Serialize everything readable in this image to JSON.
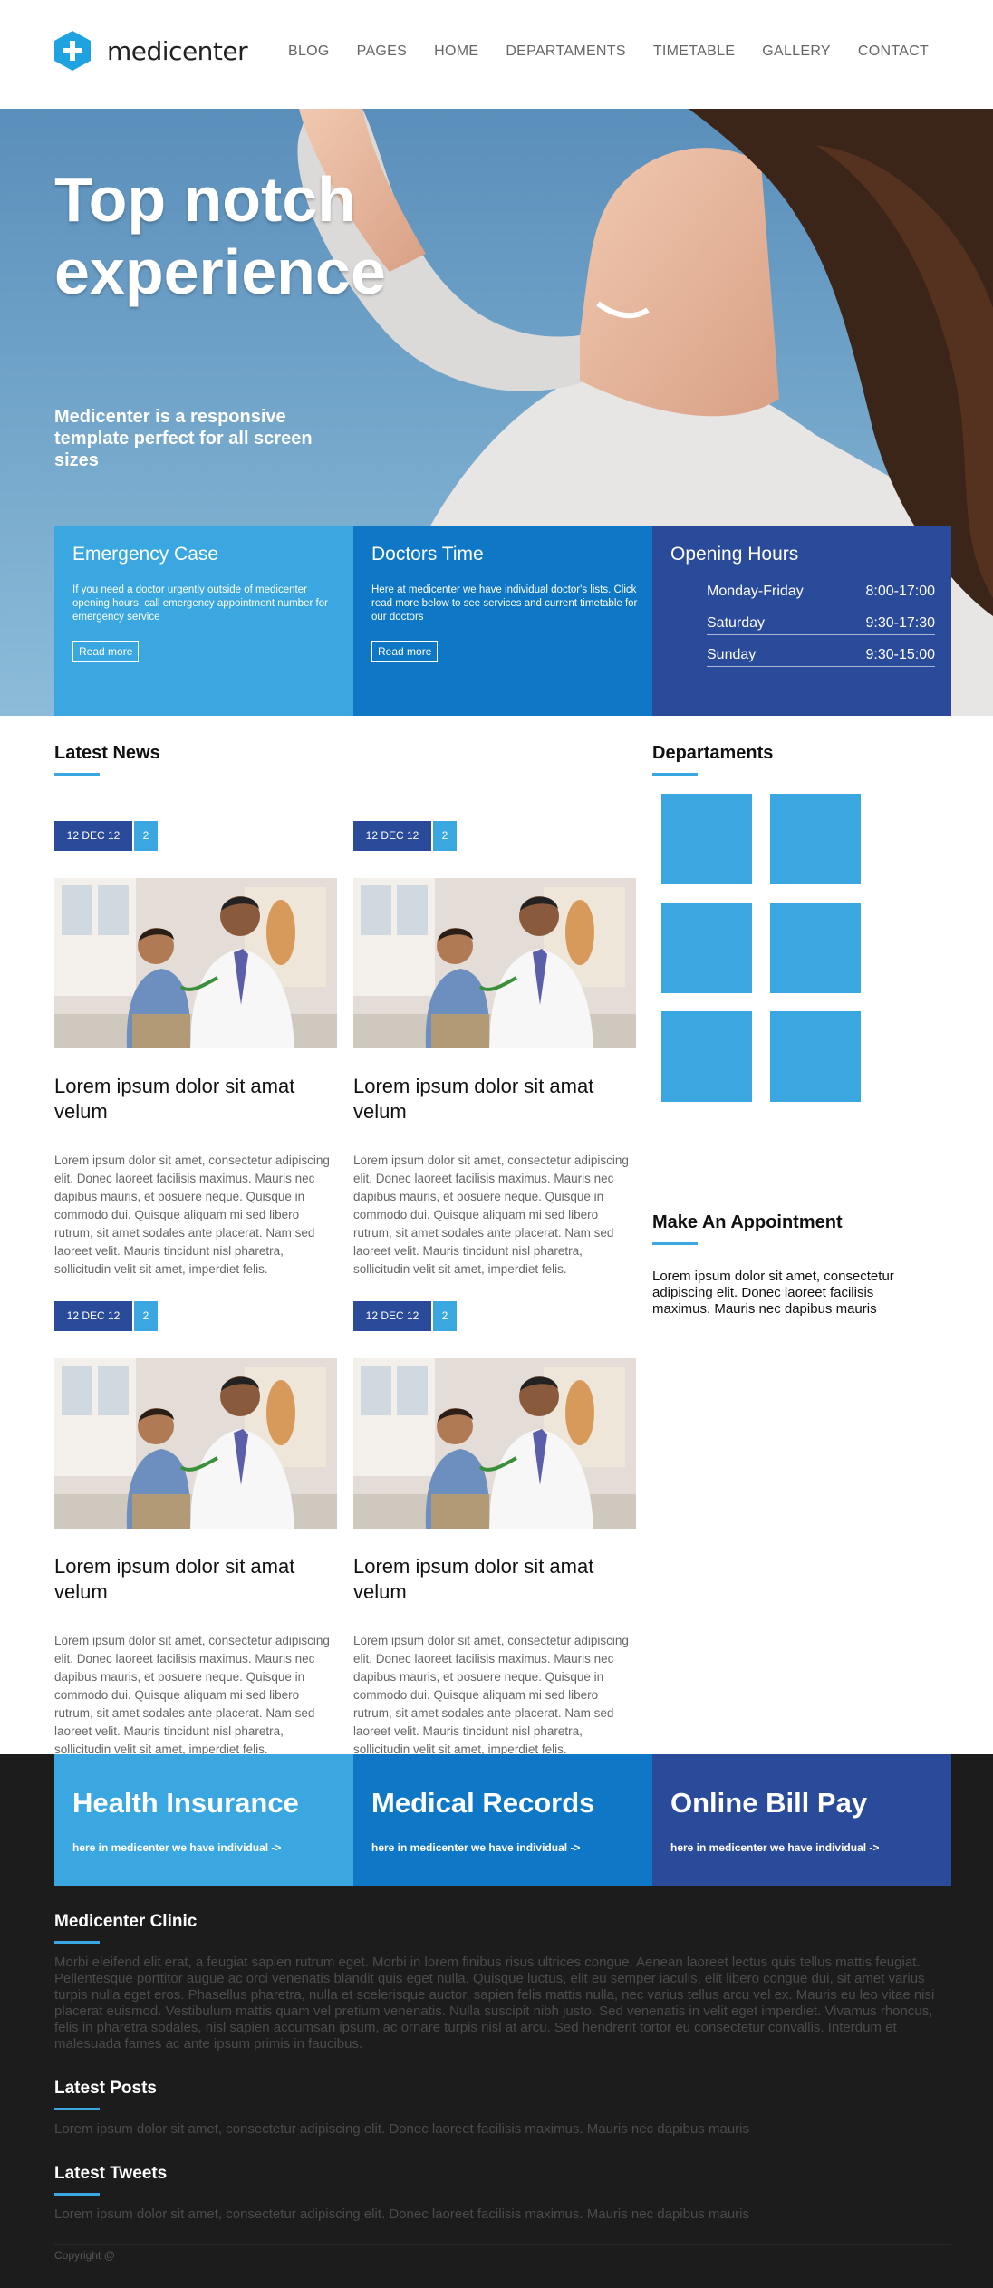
{
  "brand": {
    "name": "medicenter",
    "accent": "#3aa7e0",
    "navy": "#2a4a9a",
    "mid_blue": "#0f78c6"
  },
  "nav": [
    "BLOG",
    "PAGES",
    "HOME",
    "DEPARTAMENTS",
    "TIMETABLE",
    "GALLERY",
    "CONTACT"
  ],
  "hero": {
    "title": "Top notch experience",
    "subtitle": "Medicenter is a responsive template perfect for all screen sizes"
  },
  "info": {
    "emergency": {
      "title": "Emergency Case",
      "text": "If you need a doctor urgently outside of medicenter opening hours, call emergency appointment number for emergency service",
      "button": "Read more"
    },
    "doctors": {
      "title": "Doctors Time",
      "text": "Here at medicenter we have individual doctor's lists. Click read more below to see services and current timetable for our doctors",
      "button": "Read more"
    },
    "hours": {
      "title": "Opening Hours",
      "rows": [
        {
          "day": "Monday-Friday",
          "time": "8:00-17:00"
        },
        {
          "day": "Saturday",
          "time": "9:30-17:30"
        },
        {
          "day": "Sunday",
          "time": "9:30-15:00"
        }
      ]
    }
  },
  "news": {
    "heading": "Latest News",
    "items": [
      {
        "date": "12 DEC 12",
        "count": "2",
        "title": "Lorem ipsum dolor sit amat velum",
        "text": "Lorem ipsum dolor sit amet, consectetur adipiscing elit. Donec laoreet facilisis maximus. Mauris nec dapibus mauris, et posuere neque. Quisque in commodo dui. Quisque aliquam mi sed libero rutrum, sit amet sodales ante placerat. Nam sed laoreet velit. Mauris tincidunt nisl pharetra, sollicitudin velit sit amet, imperdiet felis."
      },
      {
        "date": "12 DEC 12",
        "count": "2",
        "title": "Lorem ipsum dolor sit amat velum",
        "text": "Lorem ipsum dolor sit amet, consectetur adipiscing elit. Donec laoreet facilisis maximus. Mauris nec dapibus mauris, et posuere neque. Quisque in commodo dui. Quisque aliquam mi sed libero rutrum, sit amet sodales ante placerat. Nam sed laoreet velit. Mauris tincidunt nisl pharetra, sollicitudin velit sit amet, imperdiet felis."
      },
      {
        "date": "12 DEC 12",
        "count": "2",
        "title": "Lorem ipsum dolor sit amat velum",
        "text": "Lorem ipsum dolor sit amet, consectetur adipiscing elit. Donec laoreet facilisis maximus. Mauris nec dapibus mauris, et posuere neque. Quisque in commodo dui. Quisque aliquam mi sed libero rutrum, sit amet sodales ante placerat. Nam sed laoreet velit. Mauris tincidunt nisl pharetra, sollicitudin velit sit amet, imperdiet felis."
      },
      {
        "date": "12 DEC 12",
        "count": "2",
        "title": "Lorem ipsum dolor sit amat velum",
        "text": "Lorem ipsum dolor sit amet, consectetur adipiscing elit. Donec laoreet facilisis maximus. Mauris nec dapibus mauris, et posuere neque. Quisque in commodo dui. Quisque aliquam mi sed libero rutrum, sit amet sodales ante placerat. Nam sed laoreet velit. Mauris tincidunt nisl pharetra, sollicitudin velit sit amet, imperdiet felis."
      }
    ]
  },
  "departments": {
    "heading": "Departaments"
  },
  "appointment": {
    "heading": "Make An Appointment",
    "text": "Lorem ipsum dolor sit amet, consectetur adipiscing elit. Donec laoreet facilisis maximus. Mauris nec dapibus mauris"
  },
  "cta": [
    {
      "title": "Health Insurance",
      "link": "here in medicenter we have individual ->"
    },
    {
      "title": "Medical Records",
      "link": "here in medicenter we have individual ->"
    },
    {
      "title": "Online Bill Pay",
      "link": "here in medicenter we have individual ->"
    }
  ],
  "footer": {
    "clinic": {
      "heading": "Medicenter Clinic",
      "text": "Morbi eleifend elit erat, a feugiat sapien rutrum eget. Morbi in lorem finibus risus ultrices congue. Aenean laoreet lectus quis tellus mattis feugiat. Pellentesque porttitor augue ac orci venenatis blandit quis eget nulla. Quisque luctus, elit eu semper iaculis, elit libero congue dui, sit amet varius turpis nulla eget eros. Phasellus pharetra, nulla et scelerisque auctor, sapien felis mattis nulla, nec varius tellus arcu vel ex. Mauris eu leo vitae nisi placerat euismod. Vestibulum mattis quam vel pretium venenatis. Nulla suscipit nibh justo. Sed venenatis in velit eget imperdiet. Vivamus rhoncus, felis in pharetra sodales, nisl sapien accumsan ipsum, ac ornare turpis nisl at arcu. Sed hendrerit tortor eu consectetur convallis. Interdum et malesuada fames ac ante ipsum primis in faucibus."
    },
    "posts": {
      "heading": "Latest Posts",
      "text": "Lorem ipsum dolor sit amet, consectetur adipiscing elit. Donec laoreet facilisis maximus. Mauris nec dapibus mauris"
    },
    "tweets": {
      "heading": "Latest Tweets",
      "text": "Lorem ipsum dolor sit amet, consectetur adipiscing elit. Donec laoreet facilisis maximus. Mauris nec dapibus mauris"
    },
    "copyright": "Copyright @"
  }
}
